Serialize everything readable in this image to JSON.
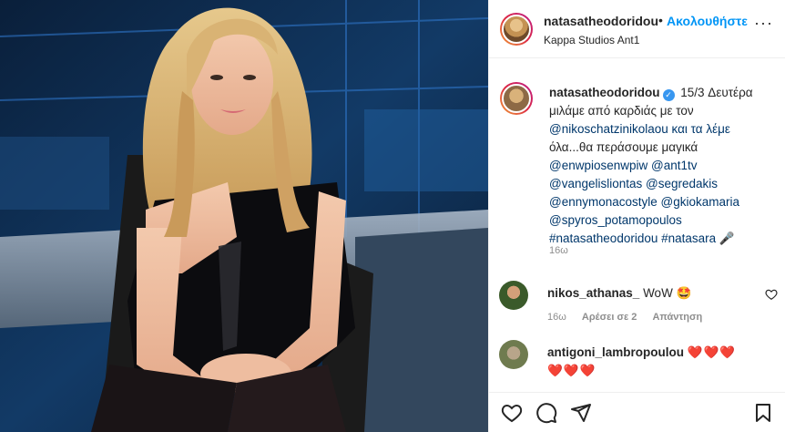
{
  "post": {
    "image_alt": "Woman in black one-shoulder dress seated in a TV studio"
  },
  "header": {
    "username": "natasatheodoridou",
    "separator": "•",
    "follow_label": "Ακολουθήστε",
    "location": "Kappa Studios Ant1",
    "more_label": "···"
  },
  "caption": {
    "username": "natasatheodoridou",
    "lines": [
      "15/3 Δευτέρα",
      "μιλάμε από καρδιάς με τον",
      "@nikoschatzinikolaou και τα λέμε",
      "όλα...θα περάσουμε μαγικά",
      "@enwpiosenwpiw @ant1tv",
      "@vangelisliontas @segredakis",
      "@ennymonacostyle @gkiokamaria",
      "@spyros_potamopoulos",
      "#natasatheodoridou #natasara 🎤"
    ],
    "time": "16ω"
  },
  "comments": [
    {
      "username": "nikos_athanas_",
      "text": "WoW 🤩",
      "time": "16ω",
      "likes": "Αρέσει σε 2",
      "reply": "Απάντηση"
    },
    {
      "username": "antigoni_lambropoulou",
      "text": "❤️❤️❤️",
      "text2": "❤️❤️❤️"
    }
  ],
  "icons": {
    "like": "heart-icon",
    "comment": "comment-icon",
    "share": "paper-plane-icon",
    "save": "bookmark-icon"
  }
}
